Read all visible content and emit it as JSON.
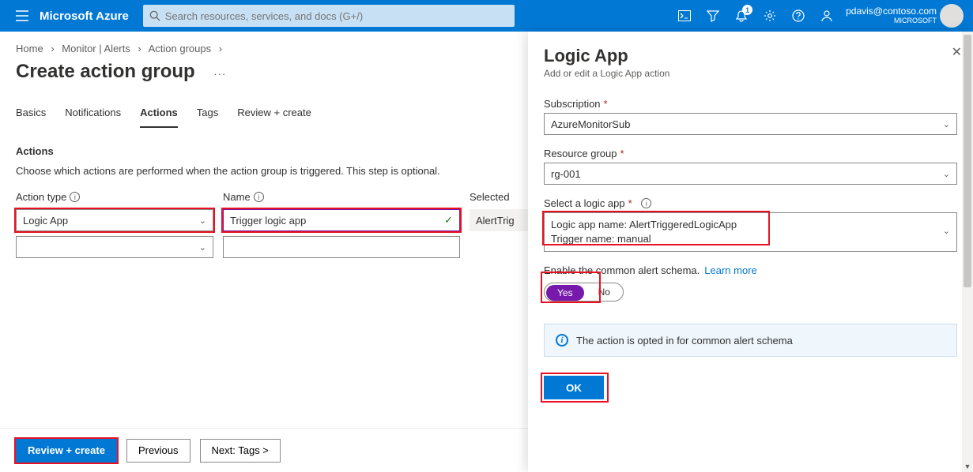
{
  "header": {
    "brand": "Microsoft Azure",
    "search_placeholder": "Search resources, services, and docs (G+/)",
    "notification_count": "1",
    "user_email": "pdavis@contoso.com",
    "user_org": "MICROSOFT"
  },
  "breadcrumb": {
    "items": [
      "Home",
      "Monitor | Alerts",
      "Action groups"
    ]
  },
  "page": {
    "title": "Create action group"
  },
  "tabs": [
    "Basics",
    "Notifications",
    "Actions",
    "Tags",
    "Review + create"
  ],
  "actions_section": {
    "heading": "Actions",
    "description": "Choose which actions are performed when the action group is triggered. This step is optional.",
    "col_action_type": "Action type",
    "col_name": "Name",
    "col_selected": "Selected",
    "row1_action_type": "Logic App",
    "row1_name": "Trigger logic app",
    "row1_selected": "AlertTrig"
  },
  "footer": {
    "review": "Review + create",
    "previous": "Previous",
    "next": "Next: Tags >"
  },
  "panel": {
    "title": "Logic App",
    "subtitle": "Add or edit a Logic App action",
    "subscription_label": "Subscription",
    "subscription_value": "AzureMonitorSub",
    "rg_label": "Resource group",
    "rg_value": "rg-001",
    "select_label": "Select a logic app",
    "logicapp_line1": "Logic app name: AlertTriggeredLogicApp",
    "logicapp_line2": "Trigger name: manual",
    "enable_text": "Enable the common alert schema.",
    "learn_more": "Learn more",
    "yes": "Yes",
    "no": "No",
    "banner": "The action is opted in for common alert schema",
    "ok": "OK"
  }
}
